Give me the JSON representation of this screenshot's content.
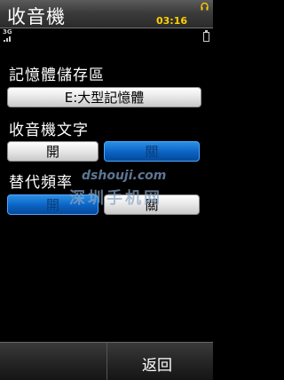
{
  "status": {
    "title": "收音機",
    "time": "03:16",
    "network": "3G"
  },
  "settings": {
    "storage_label": "記憶體儲存區",
    "storage_value": "E:大型記憶體",
    "radio_text_label": "收音機文字",
    "radio_text_on": "開",
    "radio_text_off": "關",
    "alt_freq_label": "替代頻率",
    "alt_freq_on": "開",
    "alt_freq_off": "關"
  },
  "watermark": {
    "site": "dshouji.com",
    "name": "深圳手机网"
  },
  "softkeys": {
    "right": "返回"
  },
  "colors": {
    "accent_blue": "#0a62c2",
    "time_color": "#ffd000"
  }
}
